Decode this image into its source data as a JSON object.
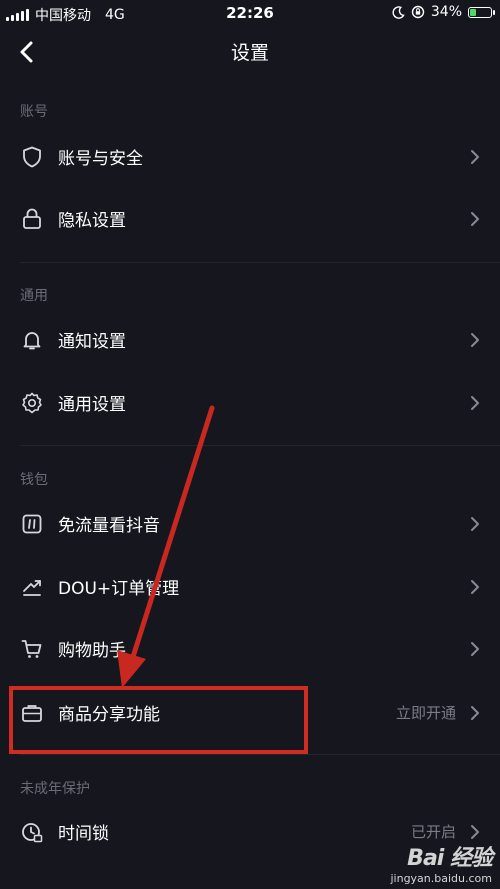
{
  "status_bar": {
    "carrier": "中国移动",
    "network": "4G",
    "time": "22:26",
    "battery_percent": "34%",
    "battery_level": 0.34
  },
  "nav": {
    "title": "设置"
  },
  "sections": {
    "account": "账号",
    "general": "通用",
    "wallet": "钱包",
    "minor": "未成年保护"
  },
  "rows": {
    "account_security": {
      "label": "账号与安全"
    },
    "privacy": {
      "label": "隐私设置"
    },
    "notifications": {
      "label": "通知设置"
    },
    "general_settings": {
      "label": "通用设置"
    },
    "free_data": {
      "label": "免流量看抖音"
    },
    "dou_orders": {
      "label": "DOU+订单管理"
    },
    "shopping_assistant": {
      "label": "购物助手"
    },
    "product_sharing": {
      "label": "商品分享功能",
      "value": "立即开通"
    },
    "time_lock": {
      "label": "时间锁",
      "value": "已开启"
    }
  },
  "watermark": {
    "brand": "Bai 经验",
    "site": "jingyan.baidu.com"
  },
  "colors": {
    "background": "#16161f",
    "highlight": "#d02c24"
  }
}
